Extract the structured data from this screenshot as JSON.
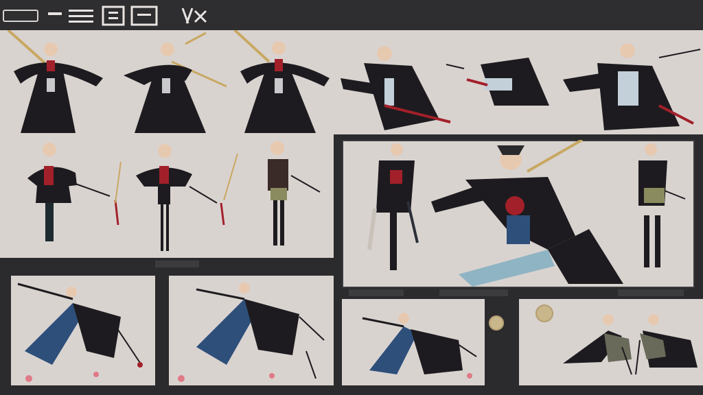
{
  "header": {
    "tag": "",
    "glyphs": []
  },
  "panels": [
    {
      "name": "pose-row-top",
      "figures": 6
    },
    {
      "name": "pose-front-row",
      "figures": 3
    },
    {
      "name": "pose-main-action",
      "figures": 3
    },
    {
      "name": "pose-bottom-left",
      "figures": 1
    },
    {
      "name": "pose-bottom-mid",
      "figures": 1
    },
    {
      "name": "pose-bottom-right-a",
      "figures": 1
    },
    {
      "name": "pose-bottom-right-b",
      "figures": 2
    }
  ],
  "colors": {
    "background": "#2b2a2c",
    "panel": "#d9d3d0",
    "cloak": "#1d1b1f",
    "accent_red": "#a2202a",
    "accent_blue": "#2d4f7a",
    "skin": "#e7c9b0",
    "staff": "#c8a862"
  }
}
